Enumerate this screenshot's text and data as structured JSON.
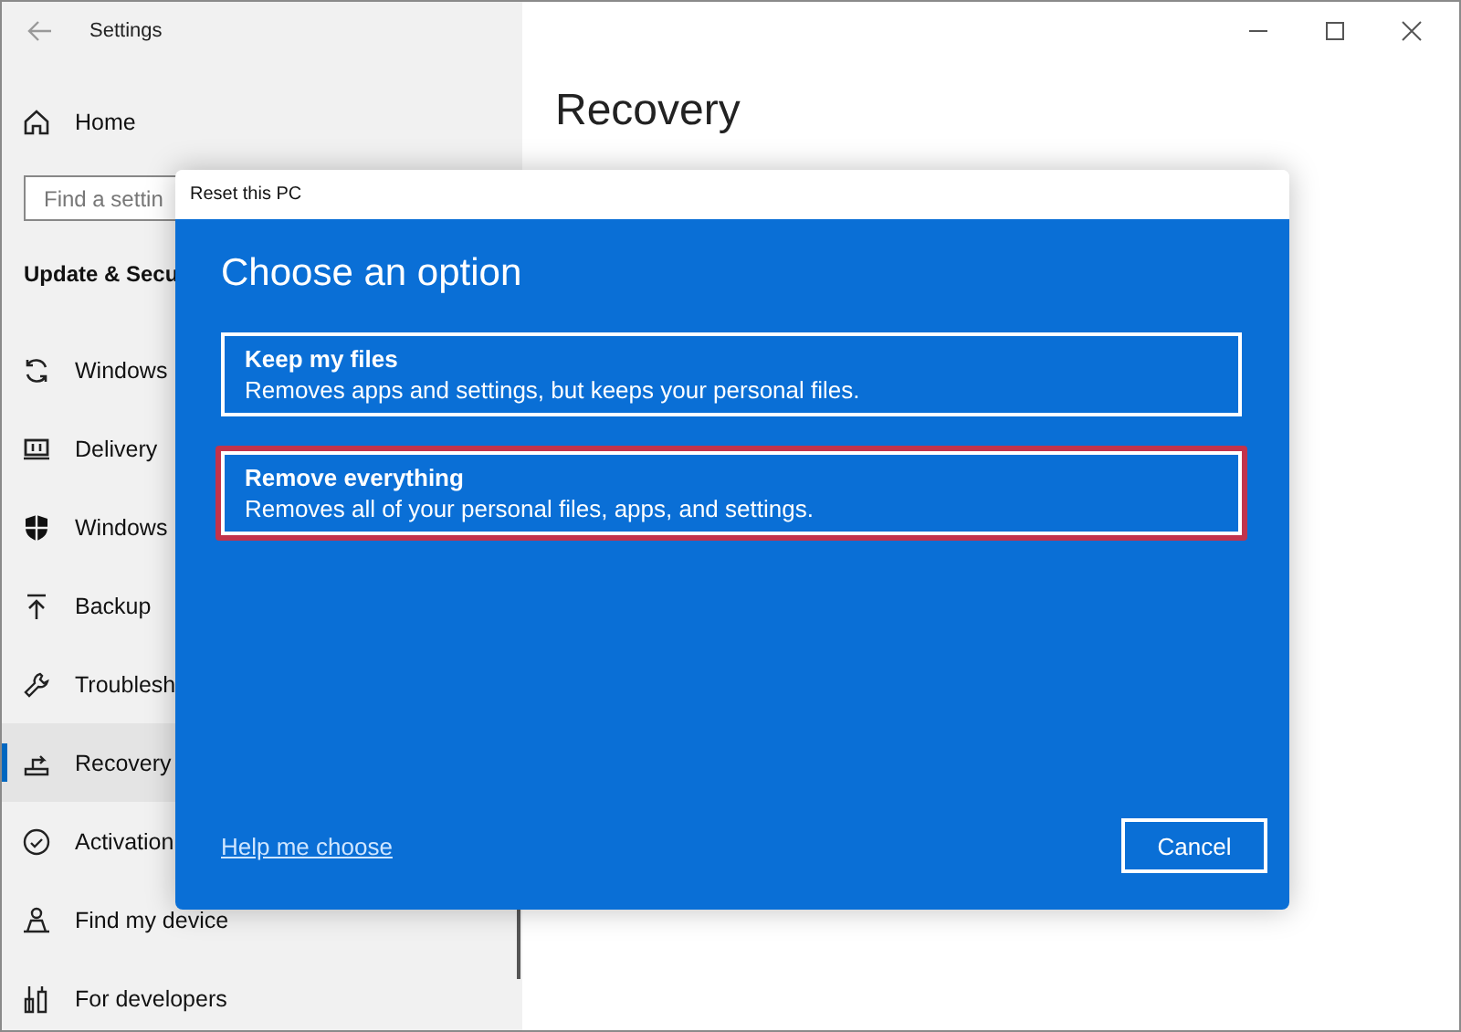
{
  "window": {
    "title": "Settings"
  },
  "sidebar": {
    "home": "Home",
    "search": {
      "placeholder": "Find a settin"
    },
    "section": "Update & Secu",
    "items": [
      {
        "label": "Windows",
        "selected": false
      },
      {
        "label": "Delivery",
        "selected": false
      },
      {
        "label": "Windows",
        "selected": false
      },
      {
        "label": "Backup",
        "selected": false
      },
      {
        "label": "Troublesh",
        "selected": false
      },
      {
        "label": "Recovery",
        "selected": true
      },
      {
        "label": "Activation",
        "selected": false
      },
      {
        "label": "Find my device",
        "selected": false
      },
      {
        "label": "For developers",
        "selected": false
      }
    ]
  },
  "page": {
    "title": "Recovery"
  },
  "dialog": {
    "title": "Reset this PC",
    "heading": "Choose an option",
    "options": [
      {
        "title": "Keep my files",
        "description": "Removes apps and settings, but keeps your personal files.",
        "selected": false
      },
      {
        "title": "Remove everything",
        "description": "Removes all of your personal files, apps, and settings.",
        "selected": true
      }
    ],
    "link": "Help me choose",
    "button": "Cancel"
  }
}
